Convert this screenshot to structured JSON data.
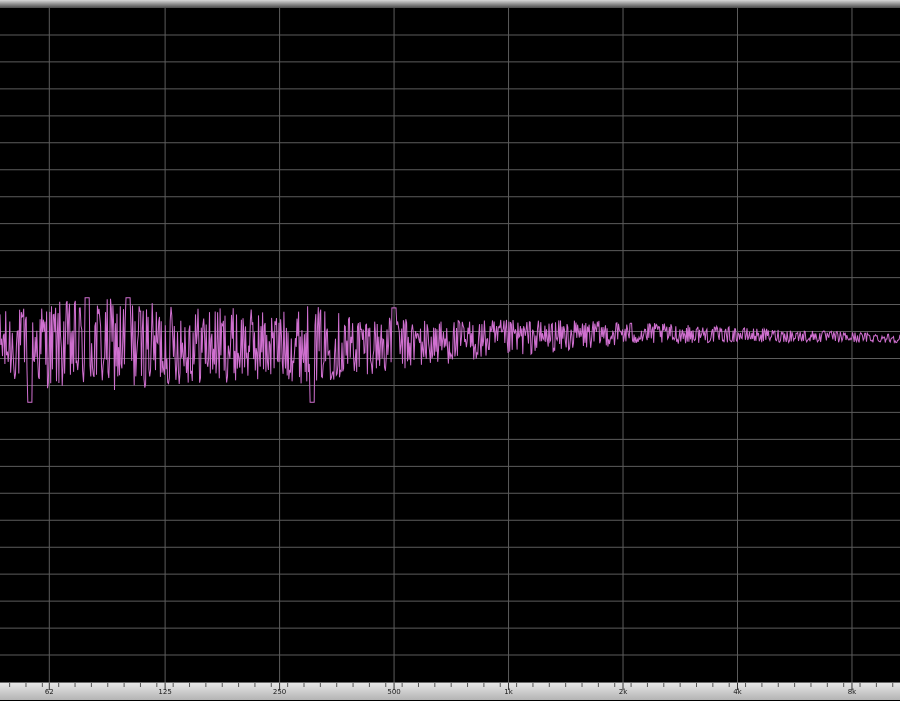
{
  "colors": {
    "background": "#000000",
    "grid": "#5c5c5c",
    "trace": "#d070d0",
    "ruler_bg": "#c8c8c8",
    "ruler_text": "#1a1a1a"
  },
  "chart_data": {
    "type": "line",
    "title": "",
    "xlabel": "",
    "ylabel": "",
    "x_scale": "log",
    "xlim": [
      46,
      10700
    ],
    "ylim": [
      -1,
      1
    ],
    "grid": true,
    "legend": "none",
    "x_ticks": [
      {
        "label": "62",
        "value": 62
      },
      {
        "label": "125",
        "value": 125
      },
      {
        "label": "250",
        "value": 250
      },
      {
        "label": "500",
        "value": 500
      },
      {
        "label": "1k",
        "value": 1000
      },
      {
        "label": "2k",
        "value": 2000
      },
      {
        "label": "4k",
        "value": 4000
      },
      {
        "label": "8k",
        "value": 8000
      }
    ],
    "y_divisions": 25,
    "series": [
      {
        "envelope": [
          {
            "x": 46,
            "amplitude": 0.1
          },
          {
            "x": 62,
            "amplitude": 0.13
          },
          {
            "x": 90,
            "amplitude": 0.14
          },
          {
            "x": 125,
            "amplitude": 0.12
          },
          {
            "x": 200,
            "amplitude": 0.11
          },
          {
            "x": 250,
            "amplitude": 0.1
          },
          {
            "x": 300,
            "amplitude": 0.12
          },
          {
            "x": 400,
            "amplitude": 0.09
          },
          {
            "x": 500,
            "amplitude": 0.08
          },
          {
            "x": 700,
            "amplitude": 0.065
          },
          {
            "x": 1000,
            "amplitude": 0.055
          },
          {
            "x": 1500,
            "amplitude": 0.045
          },
          {
            "x": 2000,
            "amplitude": 0.035
          },
          {
            "x": 4000,
            "amplitude": 0.022
          },
          {
            "x": 8000,
            "amplitude": 0.016
          },
          {
            "x": 10700,
            "amplitude": 0.013
          }
        ],
        "center": [
          {
            "x": 46,
            "y": 0.0
          },
          {
            "x": 500,
            "y": 0.0
          },
          {
            "x": 1000,
            "y": 0.02
          },
          {
            "x": 2000,
            "y": 0.035
          },
          {
            "x": 4000,
            "y": 0.03
          },
          {
            "x": 10700,
            "y": 0.02
          }
        ],
        "peaks": [
          {
            "x": 55,
            "y": -0.17
          },
          {
            "x": 78,
            "y": 0.14
          },
          {
            "x": 100,
            "y": 0.14
          },
          {
            "x": 305,
            "y": -0.17
          },
          {
            "x": 500,
            "y": 0.11
          }
        ]
      }
    ]
  }
}
